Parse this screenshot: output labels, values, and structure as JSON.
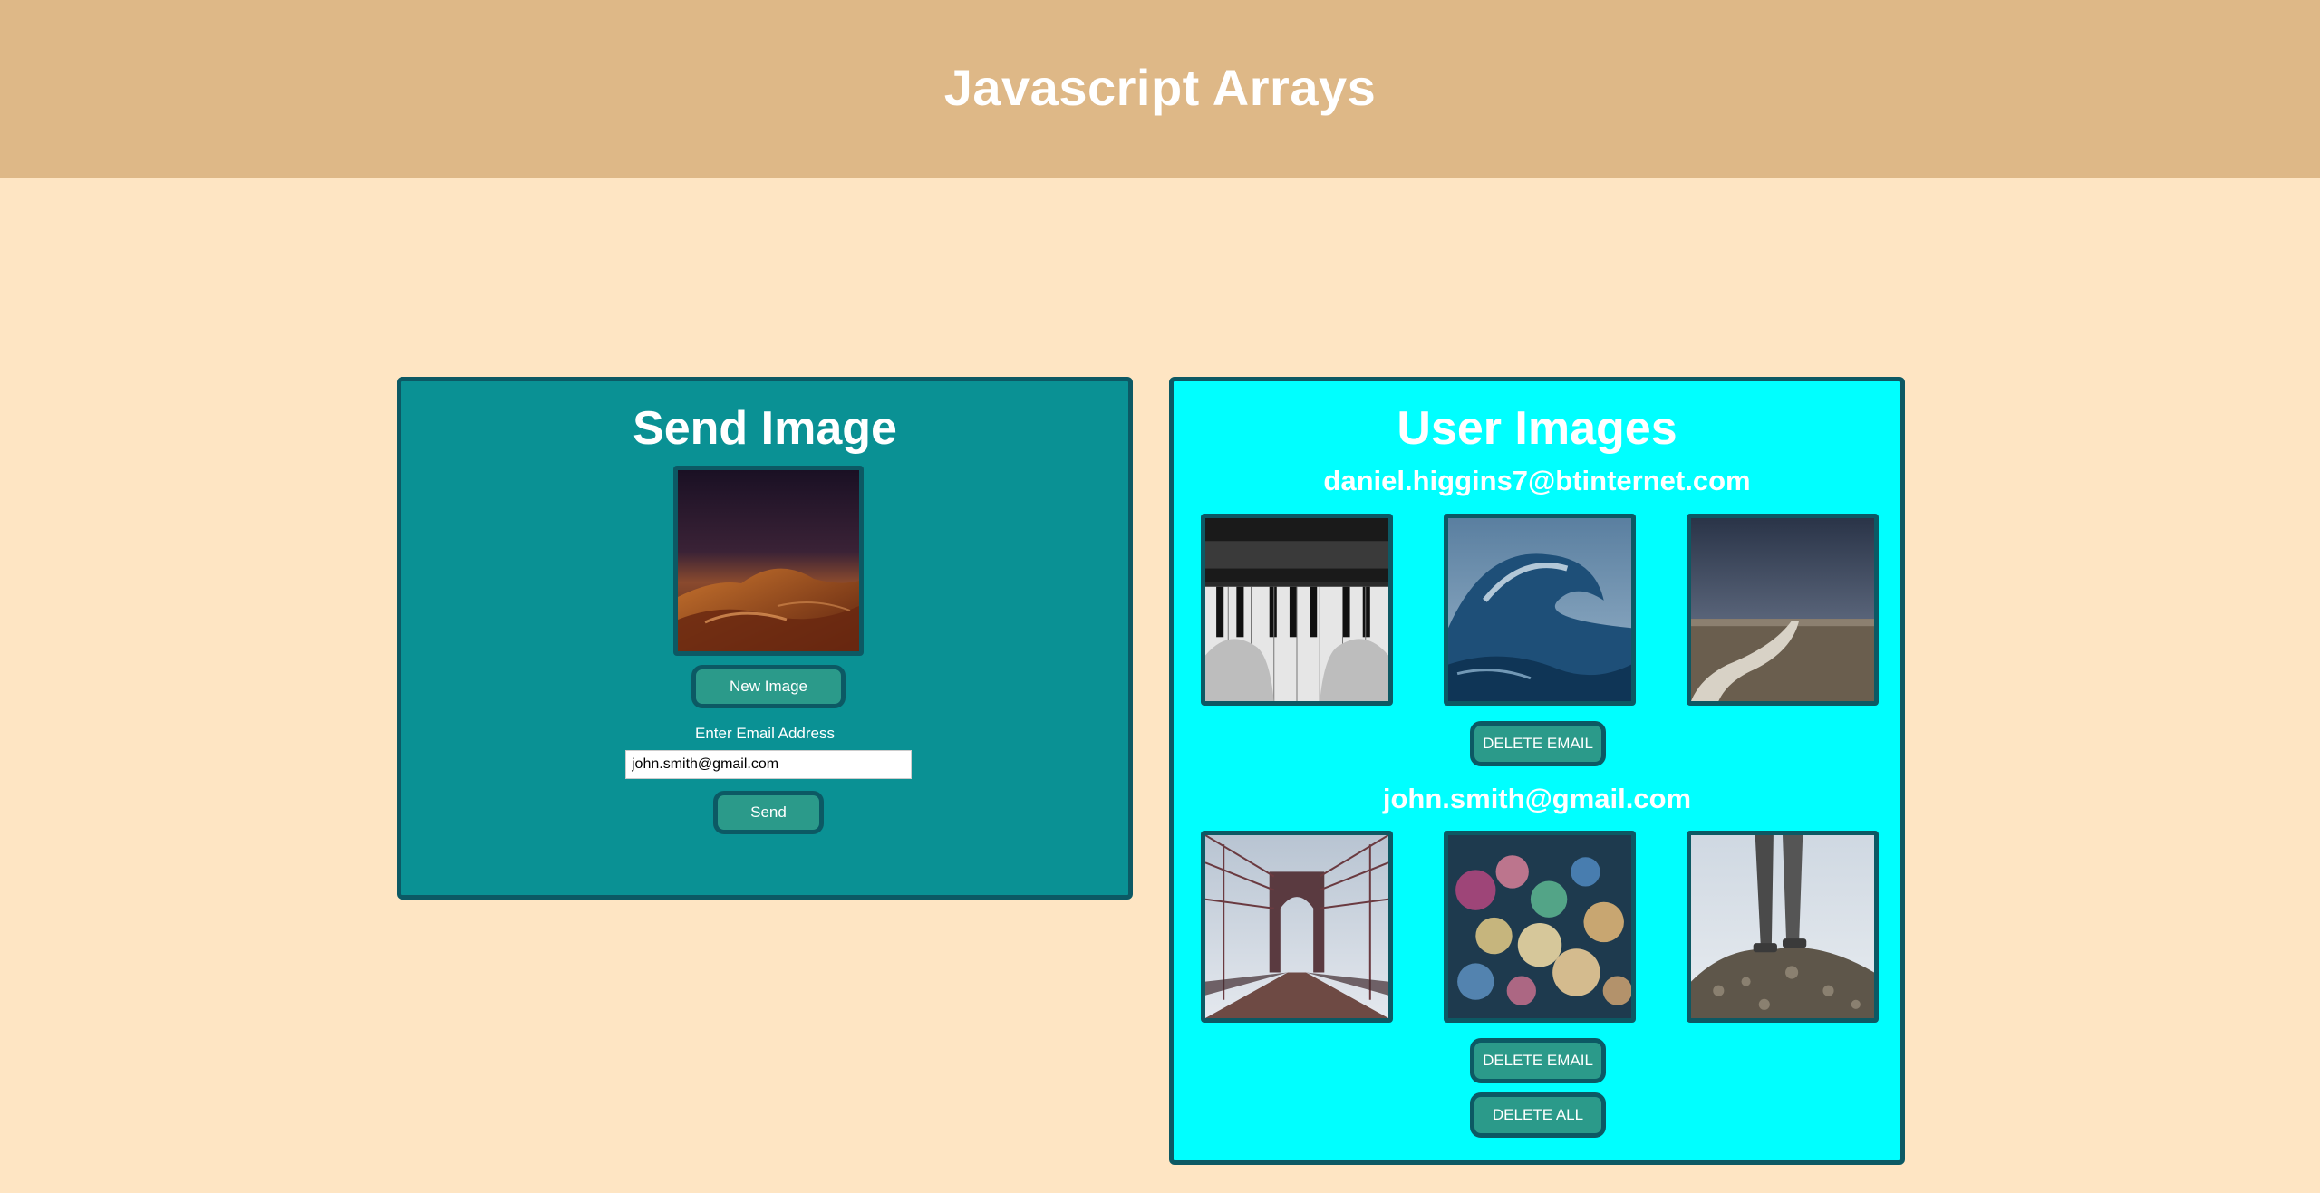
{
  "header": {
    "title": "Javascript Arrays"
  },
  "send_panel": {
    "title": "Send Image",
    "preview_image": "desert-dunes-at-dusk",
    "new_image_label": "New Image",
    "email_label": "Enter Email Address",
    "email_value": "john.smith@gmail.com",
    "send_label": "Send"
  },
  "user_panel": {
    "title": "User Images",
    "users": [
      {
        "email": "daniel.higgins7@btinternet.com",
        "images": [
          "piano-hands-bw",
          "ocean-wave",
          "country-road-field"
        ],
        "delete_label": "DELETE EMAIL"
      },
      {
        "email": "john.smith@gmail.com",
        "images": [
          "brooklyn-bridge",
          "bokeh-lights",
          "feet-on-rocks"
        ],
        "delete_label": "DELETE EMAIL"
      }
    ],
    "delete_all_label": "DELETE ALL"
  },
  "colors": {
    "page_bg": "#fee5c3",
    "header_bg": "#deb887",
    "send_panel_bg": "#0a9194",
    "user_panel_bg": "#00ffff",
    "border": "#0c5964",
    "button_bg": "#2b9a8a"
  }
}
